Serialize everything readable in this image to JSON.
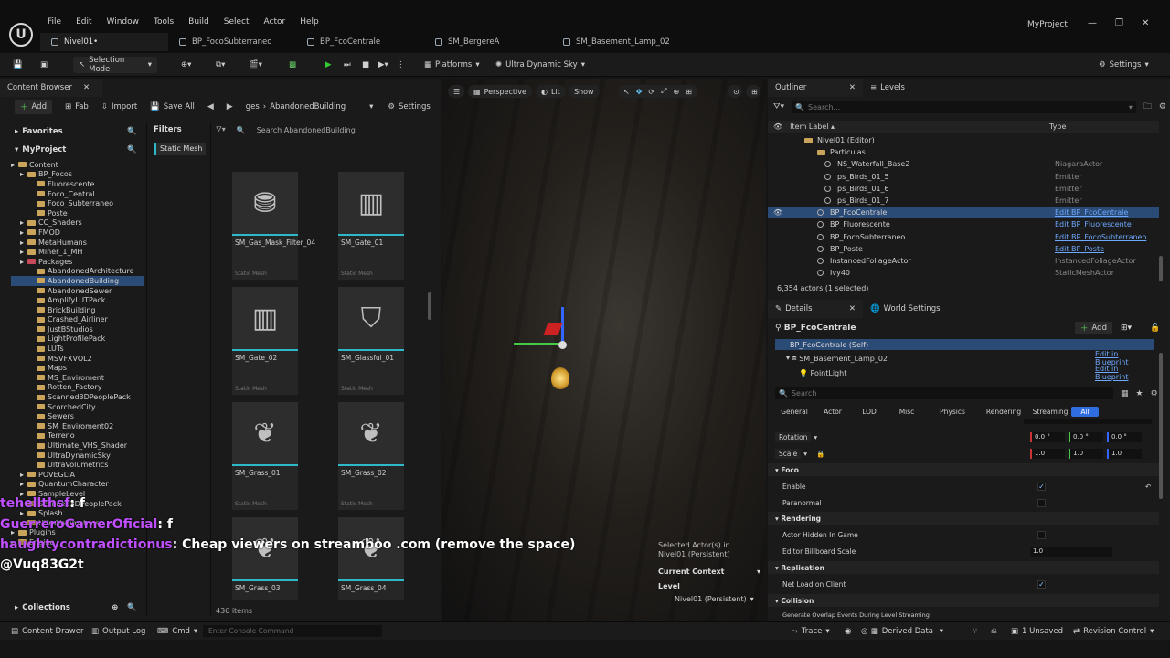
{
  "menu": [
    "File",
    "Edit",
    "Window",
    "Tools",
    "Build",
    "Select",
    "Actor",
    "Help"
  ],
  "tabs": [
    {
      "label": "Nivel01•",
      "active": true
    },
    {
      "label": "BP_FocoSubterraneo"
    },
    {
      "label": "BP_FcoCentrale"
    },
    {
      "label": "SM_BergereA"
    },
    {
      "label": "SM_Basement_Lamp_02"
    }
  ],
  "project_name": "MyProject",
  "toolbar": {
    "selection_mode": "Selection Mode",
    "platforms": "Platforms",
    "sky": "Ultra Dynamic Sky",
    "settings": "Settings"
  },
  "content_browser": {
    "title": "Content Browser",
    "add": "Add",
    "fab": "Fab",
    "import": "Import",
    "save_all": "Save All",
    "breadcrumb_prefix": "ges",
    "breadcrumb_current": "AbandonedBuilding",
    "settings": "Settings",
    "favorites": "Favorites",
    "myproject": "MyProject",
    "filters": "Filters",
    "filter_chip": "Static Mesh",
    "search_placeholder": "Search AbandonedBuilding",
    "collections": "Collections",
    "items_count": "436 items",
    "tree": [
      {
        "label": "Content",
        "depth": 0
      },
      {
        "label": "BP_Focos",
        "depth": 1
      },
      {
        "label": "Fluorescente",
        "depth": 2
      },
      {
        "label": "Foco_Central",
        "depth": 2
      },
      {
        "label": "Foco_Subterraneo",
        "depth": 2
      },
      {
        "label": "Poste",
        "depth": 2
      },
      {
        "label": "CC_Shaders",
        "depth": 1
      },
      {
        "label": "FMOD",
        "depth": 1
      },
      {
        "label": "MetaHumans",
        "depth": 1
      },
      {
        "label": "Miner_1_MH",
        "depth": 1
      },
      {
        "label": "Packages",
        "depth": 1
      },
      {
        "label": "AbandonedArchitecture",
        "depth": 2
      },
      {
        "label": "AbandonedBuilding",
        "depth": 2,
        "selected": true
      },
      {
        "label": "AbandonedSewer",
        "depth": 2
      },
      {
        "label": "AmplifyLUTPack",
        "depth": 2
      },
      {
        "label": "BrickBuilding",
        "depth": 2
      },
      {
        "label": "Crashed_Airliner",
        "depth": 2
      },
      {
        "label": "JustBStudios",
        "depth": 2
      },
      {
        "label": "LightProfilePack",
        "depth": 2
      },
      {
        "label": "LUTs",
        "depth": 2
      },
      {
        "label": "MSVFXVOL2",
        "depth": 2
      },
      {
        "label": "Maps",
        "depth": 2
      },
      {
        "label": "MS_Enviroment",
        "depth": 2
      },
      {
        "label": "Rotten_Factory",
        "depth": 2
      },
      {
        "label": "Scanned3DPeoplePack",
        "depth": 2
      },
      {
        "label": "ScorchedCity",
        "depth": 2
      },
      {
        "label": "Sewers",
        "depth": 2
      },
      {
        "label": "SM_Enviroment02",
        "depth": 2
      },
      {
        "label": "Terreno",
        "depth": 2
      },
      {
        "label": "Ultimate_VHS_Shader",
        "depth": 2
      },
      {
        "label": "UltraDynamicSky",
        "depth": 2
      },
      {
        "label": "UltraVolumetrics",
        "depth": 2
      },
      {
        "label": "POVEGLIA",
        "depth": 1
      },
      {
        "label": "QuantumCharacter",
        "depth": 1
      },
      {
        "label": "SampleLevel",
        "depth": 1
      },
      {
        "label": "Scanned3DPeoplePack",
        "depth": 1
      },
      {
        "label": "Splash",
        "depth": 1
      },
      {
        "label": "UltraVolumetrics",
        "depth": 1
      },
      {
        "label": "Plugins",
        "depth": 0
      },
      {
        "label": "Engine",
        "depth": 0
      }
    ],
    "asset_type": "Static Mesh",
    "assets": [
      {
        "name": "SM_Gas_Mask_Filter_04"
      },
      {
        "name": "SM_Gate_01"
      },
      {
        "name": "SM_Gate_02"
      },
      {
        "name": "SM_Glassful_01"
      },
      {
        "name": "SM_Grass_01"
      },
      {
        "name": "SM_Grass_02"
      },
      {
        "name": "SM_Grass_03"
      },
      {
        "name": "SM_Grass_04"
      }
    ]
  },
  "viewport": {
    "perspective": "Perspective",
    "lit": "Lit",
    "show": "Show",
    "selected_actors": "Selected Actor(s) in Nivel01 (Persistent)",
    "current_context": "Current Context",
    "level_label": "Level",
    "level_value": "Nivel01 (Persistent)"
  },
  "outliner": {
    "title": "Outliner",
    "levels_tab": "Levels",
    "search_placeholder": "Search...",
    "col_label": "Item Label",
    "col_type": "Type",
    "rows": [
      {
        "label": "Nivel01 (Editor)",
        "type": "",
        "indent": 40
      },
      {
        "label": "Particulas",
        "type": "",
        "indent": 54
      },
      {
        "label": "NS_Waterfall_Base2",
        "type": "NiagaraActor",
        "indent": 62
      },
      {
        "label": "ps_Birds_01_5",
        "type": "Emitter",
        "indent": 62
      },
      {
        "label": "ps_Birds_01_6",
        "type": "Emitter",
        "indent": 62
      },
      {
        "label": "ps_Birds_01_7",
        "type": "Emitter",
        "indent": 62
      },
      {
        "label": "BP_FcoCentrale",
        "type": "Edit BP_FcoCentrale",
        "indent": 54,
        "selected": true,
        "link": true
      },
      {
        "label": "BP_Fluorescente",
        "type": "Edit BP_Fluorescente",
        "indent": 54,
        "link": true
      },
      {
        "label": "BP_FocoSubterraneo",
        "type": "Edit BP_FocoSubterraneo",
        "indent": 54,
        "link": true
      },
      {
        "label": "BP_Poste",
        "type": "Edit BP_Poste",
        "indent": 54,
        "link": true
      },
      {
        "label": "InstancedFoliageActor",
        "type": "InstancedFoliageActor",
        "indent": 54
      },
      {
        "label": "Ivy40",
        "type": "StaticMeshActor",
        "indent": 54
      }
    ],
    "footer": "6,354 actors (1 selected)"
  },
  "details": {
    "title": "Details",
    "world_settings": "World Settings",
    "actor_name": "BP_FcoCentrale",
    "add": "Add",
    "components": [
      {
        "label": "BP_FcoCentrale (Self)",
        "edit": ""
      },
      {
        "label": "SM_Basement_Lamp_02",
        "edit": "Edit in Blueprint"
      },
      {
        "label": "PointLight",
        "edit": "Edit in Blueprint"
      }
    ],
    "search_placeholder": "Search",
    "filter_tabs": [
      "General",
      "Actor",
      "LOD",
      "Misc",
      "Physics",
      "Rendering",
      "Streaming",
      "All"
    ],
    "rotation_label": "Rotation",
    "rotation": [
      "0.0 °",
      "0.0 °",
      "0.0 °"
    ],
    "scale_label": "Scale",
    "scale": [
      "1.0",
      "1.0",
      "1.0"
    ],
    "cat_foco": "Foco",
    "enable": "Enable",
    "paranormal": "Paranormal",
    "cat_rendering": "Rendering",
    "actor_hidden": "Actor Hidden In Game",
    "billboard_scale": "Editor Billboard Scale",
    "billboard_value": "1.0",
    "cat_replication": "Replication",
    "net_load": "Net Load on Client",
    "cat_collision": "Collision",
    "overlap": "Generate Overlap Events During Level Streaming"
  },
  "statusbar": {
    "content_drawer": "Content Drawer",
    "output_log": "Output Log",
    "cmd": "Cmd",
    "console_placeholder": "Enter Console Command",
    "trace": "Trace",
    "derived_data": "Derived Data",
    "unsaved": "1 Unsaved",
    "revision": "Revision Control"
  },
  "chat": [
    {
      "user": "tehellthsf",
      "msg": "f",
      "color": "#c050ff"
    },
    {
      "user": "GuerreroGamerOficial",
      "msg": "f",
      "color": "#c050ff"
    },
    {
      "user": "haughtycontradictionus",
      "msg": "Cheap viewers on streamboo .com (remove the space)",
      "color": "#c050ff"
    },
    {
      "user": "",
      "msg": "@Vuq83G2t",
      "color": "#ffffff"
    }
  ]
}
